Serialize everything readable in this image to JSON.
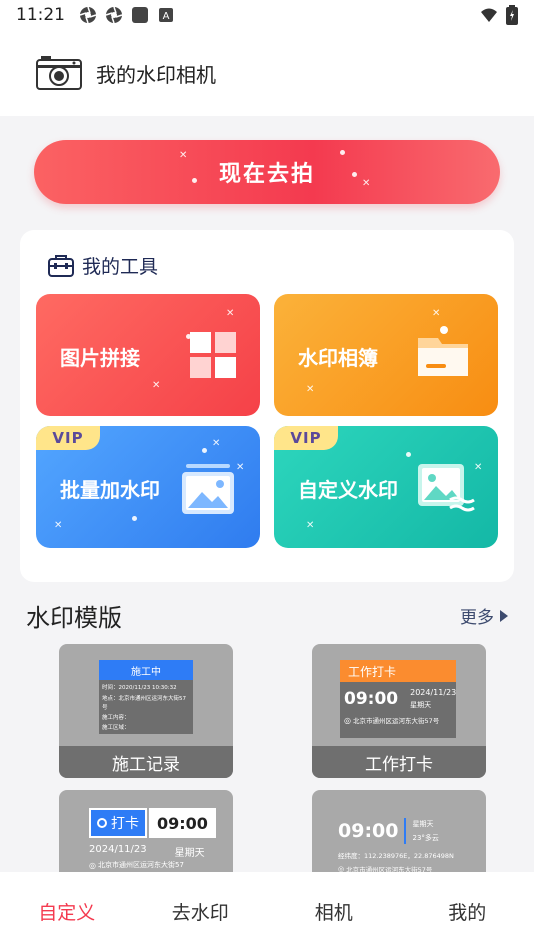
{
  "status_bar": {
    "time": "11:21"
  },
  "header": {
    "title": "我的水印相机"
  },
  "shoot_button": {
    "label": "现在去拍"
  },
  "tools": {
    "title": "我的工具",
    "items": [
      {
        "label": "图片拼接",
        "vip": false,
        "icon": "grid-window-icon",
        "color": "#f75355"
      },
      {
        "label": "水印相簿",
        "vip": false,
        "icon": "folder-icon",
        "color": "#fa9e1f"
      },
      {
        "label": "批量加水印",
        "vip": true,
        "badge": "VIP",
        "icon": "image-stack-icon",
        "color": "#3d8ff5"
      },
      {
        "label": "自定义水印",
        "vip": true,
        "badge": "VIP",
        "icon": "image-edit-icon",
        "color": "#23c4b0"
      }
    ]
  },
  "templates_section": {
    "title": "水印模版",
    "more": "更多"
  },
  "templates": [
    {
      "caption": "施工记录",
      "header": "施工中",
      "lines": [
        "时间：2020/11/23   10:30:32",
        "地点：北京市通州区运河东大街57",
        "号",
        "施工内容：",
        "施工区域："
      ]
    },
    {
      "caption": "工作打卡",
      "header": "工作打卡",
      "time": "09:00",
      "date": "2024/11/23",
      "weekday": "星期天",
      "address": "北京市通州区运河东大街57号"
    },
    {
      "caption": "",
      "badge": "打卡",
      "time": "09:00",
      "date": "2024/11/23",
      "weekday": "星期天",
      "address": "北京市通州区运河东大街57"
    },
    {
      "caption": "",
      "time": "09:00",
      "weekday": "星期天",
      "weather": "23°多云",
      "coords": "经纬度：112.238976E，22.876498N",
      "address": "北京市通州区运河东大街57号"
    }
  ],
  "bottom_nav": {
    "items": [
      {
        "label": "自定义",
        "active": true
      },
      {
        "label": "去水印",
        "active": false
      },
      {
        "label": "相机",
        "active": false
      },
      {
        "label": "我的",
        "active": false
      }
    ]
  },
  "colors": {
    "accent": "#f43a4f",
    "nav_text": "#333333",
    "vip_badge": "#ffe58a"
  }
}
